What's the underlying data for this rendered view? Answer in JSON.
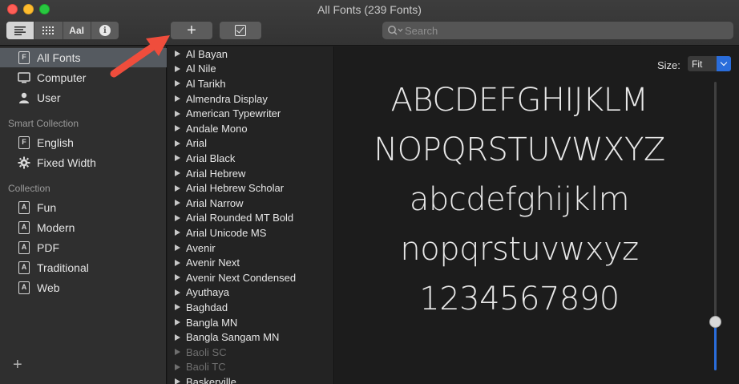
{
  "window": {
    "title": "All Fonts (239 Fonts)"
  },
  "toolbar": {
    "view_buttons": [
      {
        "icon": "list-icon"
      },
      {
        "icon": "grid-icon"
      },
      {
        "icon": "sample-text-icon",
        "label": "AaI"
      },
      {
        "icon": "info-icon",
        "label": "i"
      }
    ],
    "add_label": "+",
    "search": {
      "placeholder": "Search"
    }
  },
  "sidebar": {
    "library_items": [
      {
        "label": "All Fonts",
        "icon": "font-book-icon",
        "selected": true
      },
      {
        "label": "Computer",
        "icon": "computer-icon"
      },
      {
        "label": "User",
        "icon": "user-icon"
      }
    ],
    "smart_header": "Smart Collection",
    "smart_items": [
      {
        "label": "English",
        "icon": "font-collection-icon"
      },
      {
        "label": "Fixed Width",
        "icon": "gear-icon"
      }
    ],
    "collection_header": "Collection",
    "collection_items": [
      {
        "label": "Fun",
        "icon": "font-collection-icon"
      },
      {
        "label": "Modern",
        "icon": "font-collection-icon"
      },
      {
        "label": "PDF",
        "icon": "font-collection-icon"
      },
      {
        "label": "Traditional",
        "icon": "font-collection-icon"
      },
      {
        "label": "Web",
        "icon": "font-collection-icon"
      }
    ],
    "add_label": "+"
  },
  "fonts": [
    {
      "name": "Al Bayan"
    },
    {
      "name": "Al Nile"
    },
    {
      "name": "Al Tarikh"
    },
    {
      "name": "Almendra Display"
    },
    {
      "name": "American Typewriter"
    },
    {
      "name": "Andale Mono"
    },
    {
      "name": "Arial"
    },
    {
      "name": "Arial Black"
    },
    {
      "name": "Arial Hebrew"
    },
    {
      "name": "Arial Hebrew Scholar"
    },
    {
      "name": "Arial Narrow"
    },
    {
      "name": "Arial Rounded MT Bold"
    },
    {
      "name": "Arial Unicode MS"
    },
    {
      "name": "Avenir"
    },
    {
      "name": "Avenir Next"
    },
    {
      "name": "Avenir Next Condensed"
    },
    {
      "name": "Ayuthaya"
    },
    {
      "name": "Baghdad"
    },
    {
      "name": "Bangla MN"
    },
    {
      "name": "Bangla Sangam MN"
    },
    {
      "name": "Baoli SC",
      "disabled": true
    },
    {
      "name": "Baoli TC",
      "disabled": true
    },
    {
      "name": "Baskerville"
    }
  ],
  "preview": {
    "size_label": "Size:",
    "size_value": "Fit",
    "sample_lines": [
      "ABCDEFGHIJKLM",
      "NOPQRSTUVWXYZ",
      "abcdefghijklm",
      "nopqrstuvwxyz",
      "1234567890"
    ],
    "slider_level": 0.17
  },
  "colors": {
    "accent": "#2a6ddb",
    "annotation_arrow": "#ef4d3c",
    "selection": "#555a60"
  }
}
